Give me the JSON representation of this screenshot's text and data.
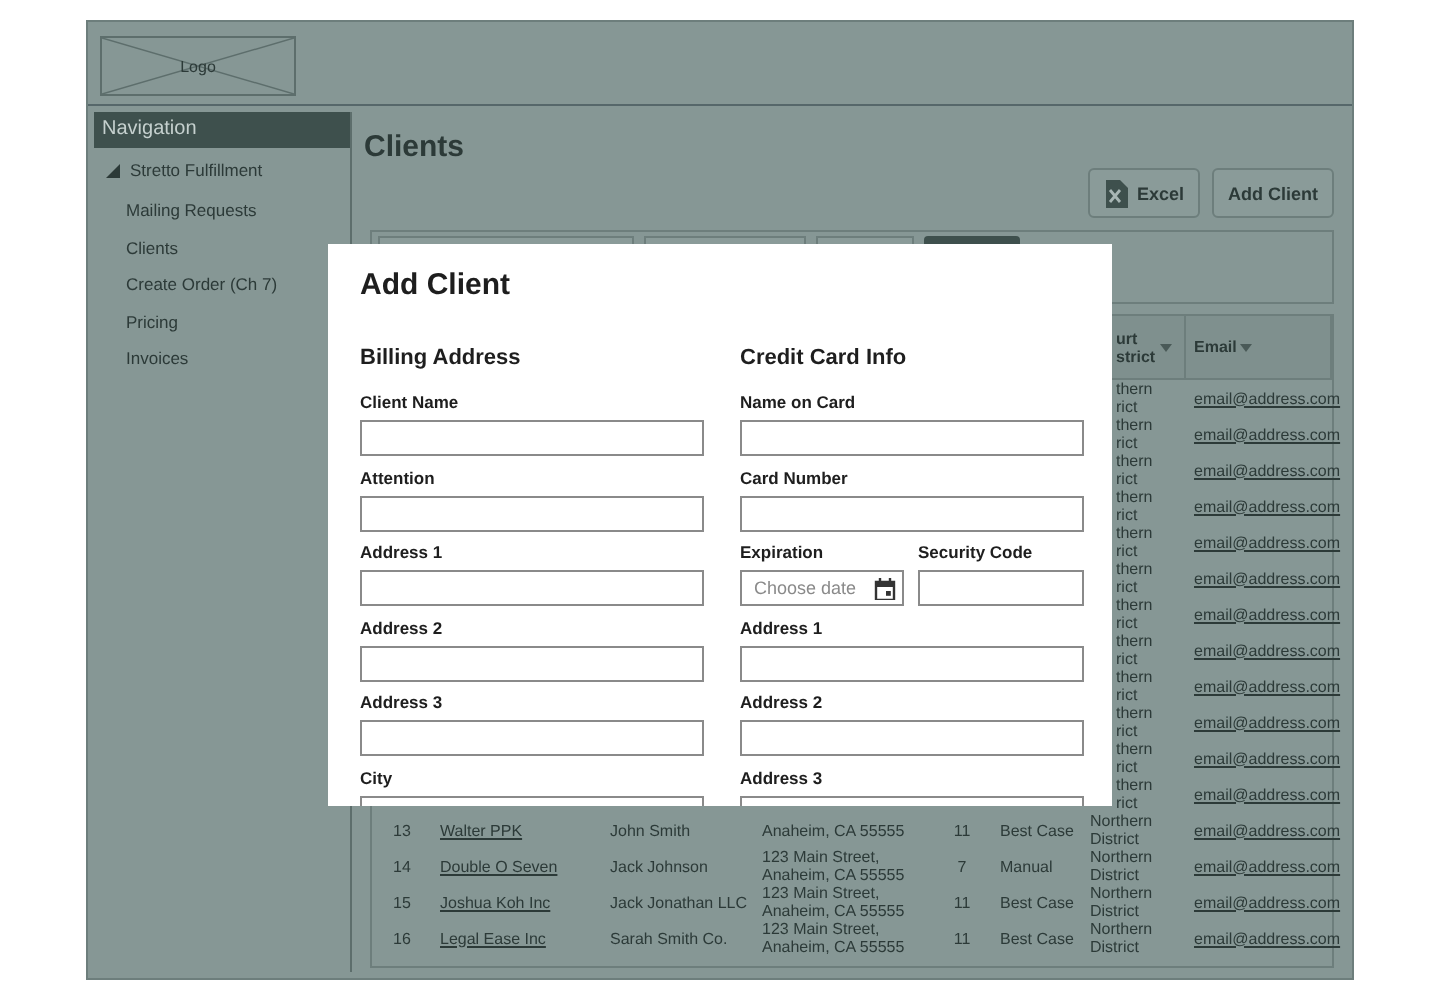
{
  "header": {
    "logo": "Logo"
  },
  "nav": {
    "title": "Navigation",
    "items": [
      {
        "label": "Stretto Fulfillment",
        "expanded": true,
        "children": [
          {
            "label": "Mailing Requests"
          },
          {
            "label": "Clients"
          },
          {
            "label": "Create Order (Ch 7)"
          },
          {
            "label": "Pricing"
          },
          {
            "label": "Invoices"
          }
        ]
      }
    ]
  },
  "page": {
    "title": "Clients",
    "buttons": [
      {
        "label": "Excel",
        "kind": "excel"
      },
      {
        "label": "Add Client",
        "kind": "plain"
      }
    ]
  },
  "table": {
    "columns": [
      {
        "label": "urt strict"
      },
      {
        "label": "Email"
      }
    ],
    "rows_under_dialog": [
      {
        "district": "thern rict",
        "email": "email@address.com"
      },
      {
        "district": "thern rict",
        "email": "email@address.com"
      },
      {
        "district": "thern rict",
        "email": "email@address.com"
      },
      {
        "district": "thern rict",
        "email": "email@address.com"
      },
      {
        "district": "thern rict",
        "email": "email@address.com"
      },
      {
        "district": "thern rict",
        "email": "email@address.com"
      },
      {
        "district": "thern rict",
        "email": "email@address.com"
      },
      {
        "district": "thern rict",
        "email": "email@address.com"
      },
      {
        "district": "thern rict",
        "email": "email@address.com"
      },
      {
        "district": "thern rict",
        "email": "email@address.com"
      },
      {
        "district": "thern rict",
        "email": "email@address.com"
      },
      {
        "district": "thern rict",
        "email": "email@address.com"
      }
    ],
    "rows": [
      {
        "number": "13",
        "client": "Walter PPK",
        "contact": "John Smith",
        "address": "Anaheim, CA 55555",
        "chapter": "11",
        "type": "Best Case",
        "district": "Northern District",
        "email": "email@address.com"
      },
      {
        "number": "14",
        "client": "Double O Seven",
        "contact": "Jack Johnson",
        "address": "123 Main Street, Anaheim, CA 55555",
        "chapter": "7",
        "type": "Manual",
        "district": "Northern District",
        "email": "email@address.com"
      },
      {
        "number": "15",
        "client": "Joshua Koh Inc",
        "contact": "Jack Jonathan LLC",
        "address": "123 Main Street, Anaheim, CA 55555",
        "chapter": "11",
        "type": "Best Case",
        "district": "Northern District",
        "email": "email@address.com"
      },
      {
        "number": "16",
        "client": "Legal Ease Inc",
        "contact": "Sarah Smith Co.",
        "address": "123 Main Street, Anaheim, CA 55555",
        "chapter": "11",
        "type": "Best Case",
        "district": "Northern District",
        "email": "email@address.com"
      }
    ]
  },
  "dialog": {
    "title": "Add Client",
    "sections": [
      {
        "heading": "Billing Address",
        "fields": [
          {
            "kind": "text",
            "label": "Client Name"
          },
          {
            "kind": "text",
            "label": "Attention"
          },
          {
            "kind": "text",
            "label": "Address 1"
          },
          {
            "kind": "text",
            "label": "Address 2"
          },
          {
            "kind": "text",
            "label": "Address 3"
          },
          {
            "kind": "text",
            "label": "City"
          }
        ]
      },
      {
        "heading": "Credit Card Info",
        "fields": [
          {
            "kind": "text",
            "label": "Name on Card"
          },
          {
            "kind": "text",
            "label": "Card Number"
          },
          {
            "kind": "split",
            "parts": [
              {
                "kind": "date",
                "label": "Expiration",
                "placeholder": "Choose date"
              },
              {
                "kind": "text",
                "label": "Security Code"
              }
            ]
          },
          {
            "kind": "text",
            "label": "Address 1"
          },
          {
            "kind": "text",
            "label": "Address 2"
          },
          {
            "kind": "text",
            "label": "Address 3"
          }
        ]
      }
    ]
  }
}
